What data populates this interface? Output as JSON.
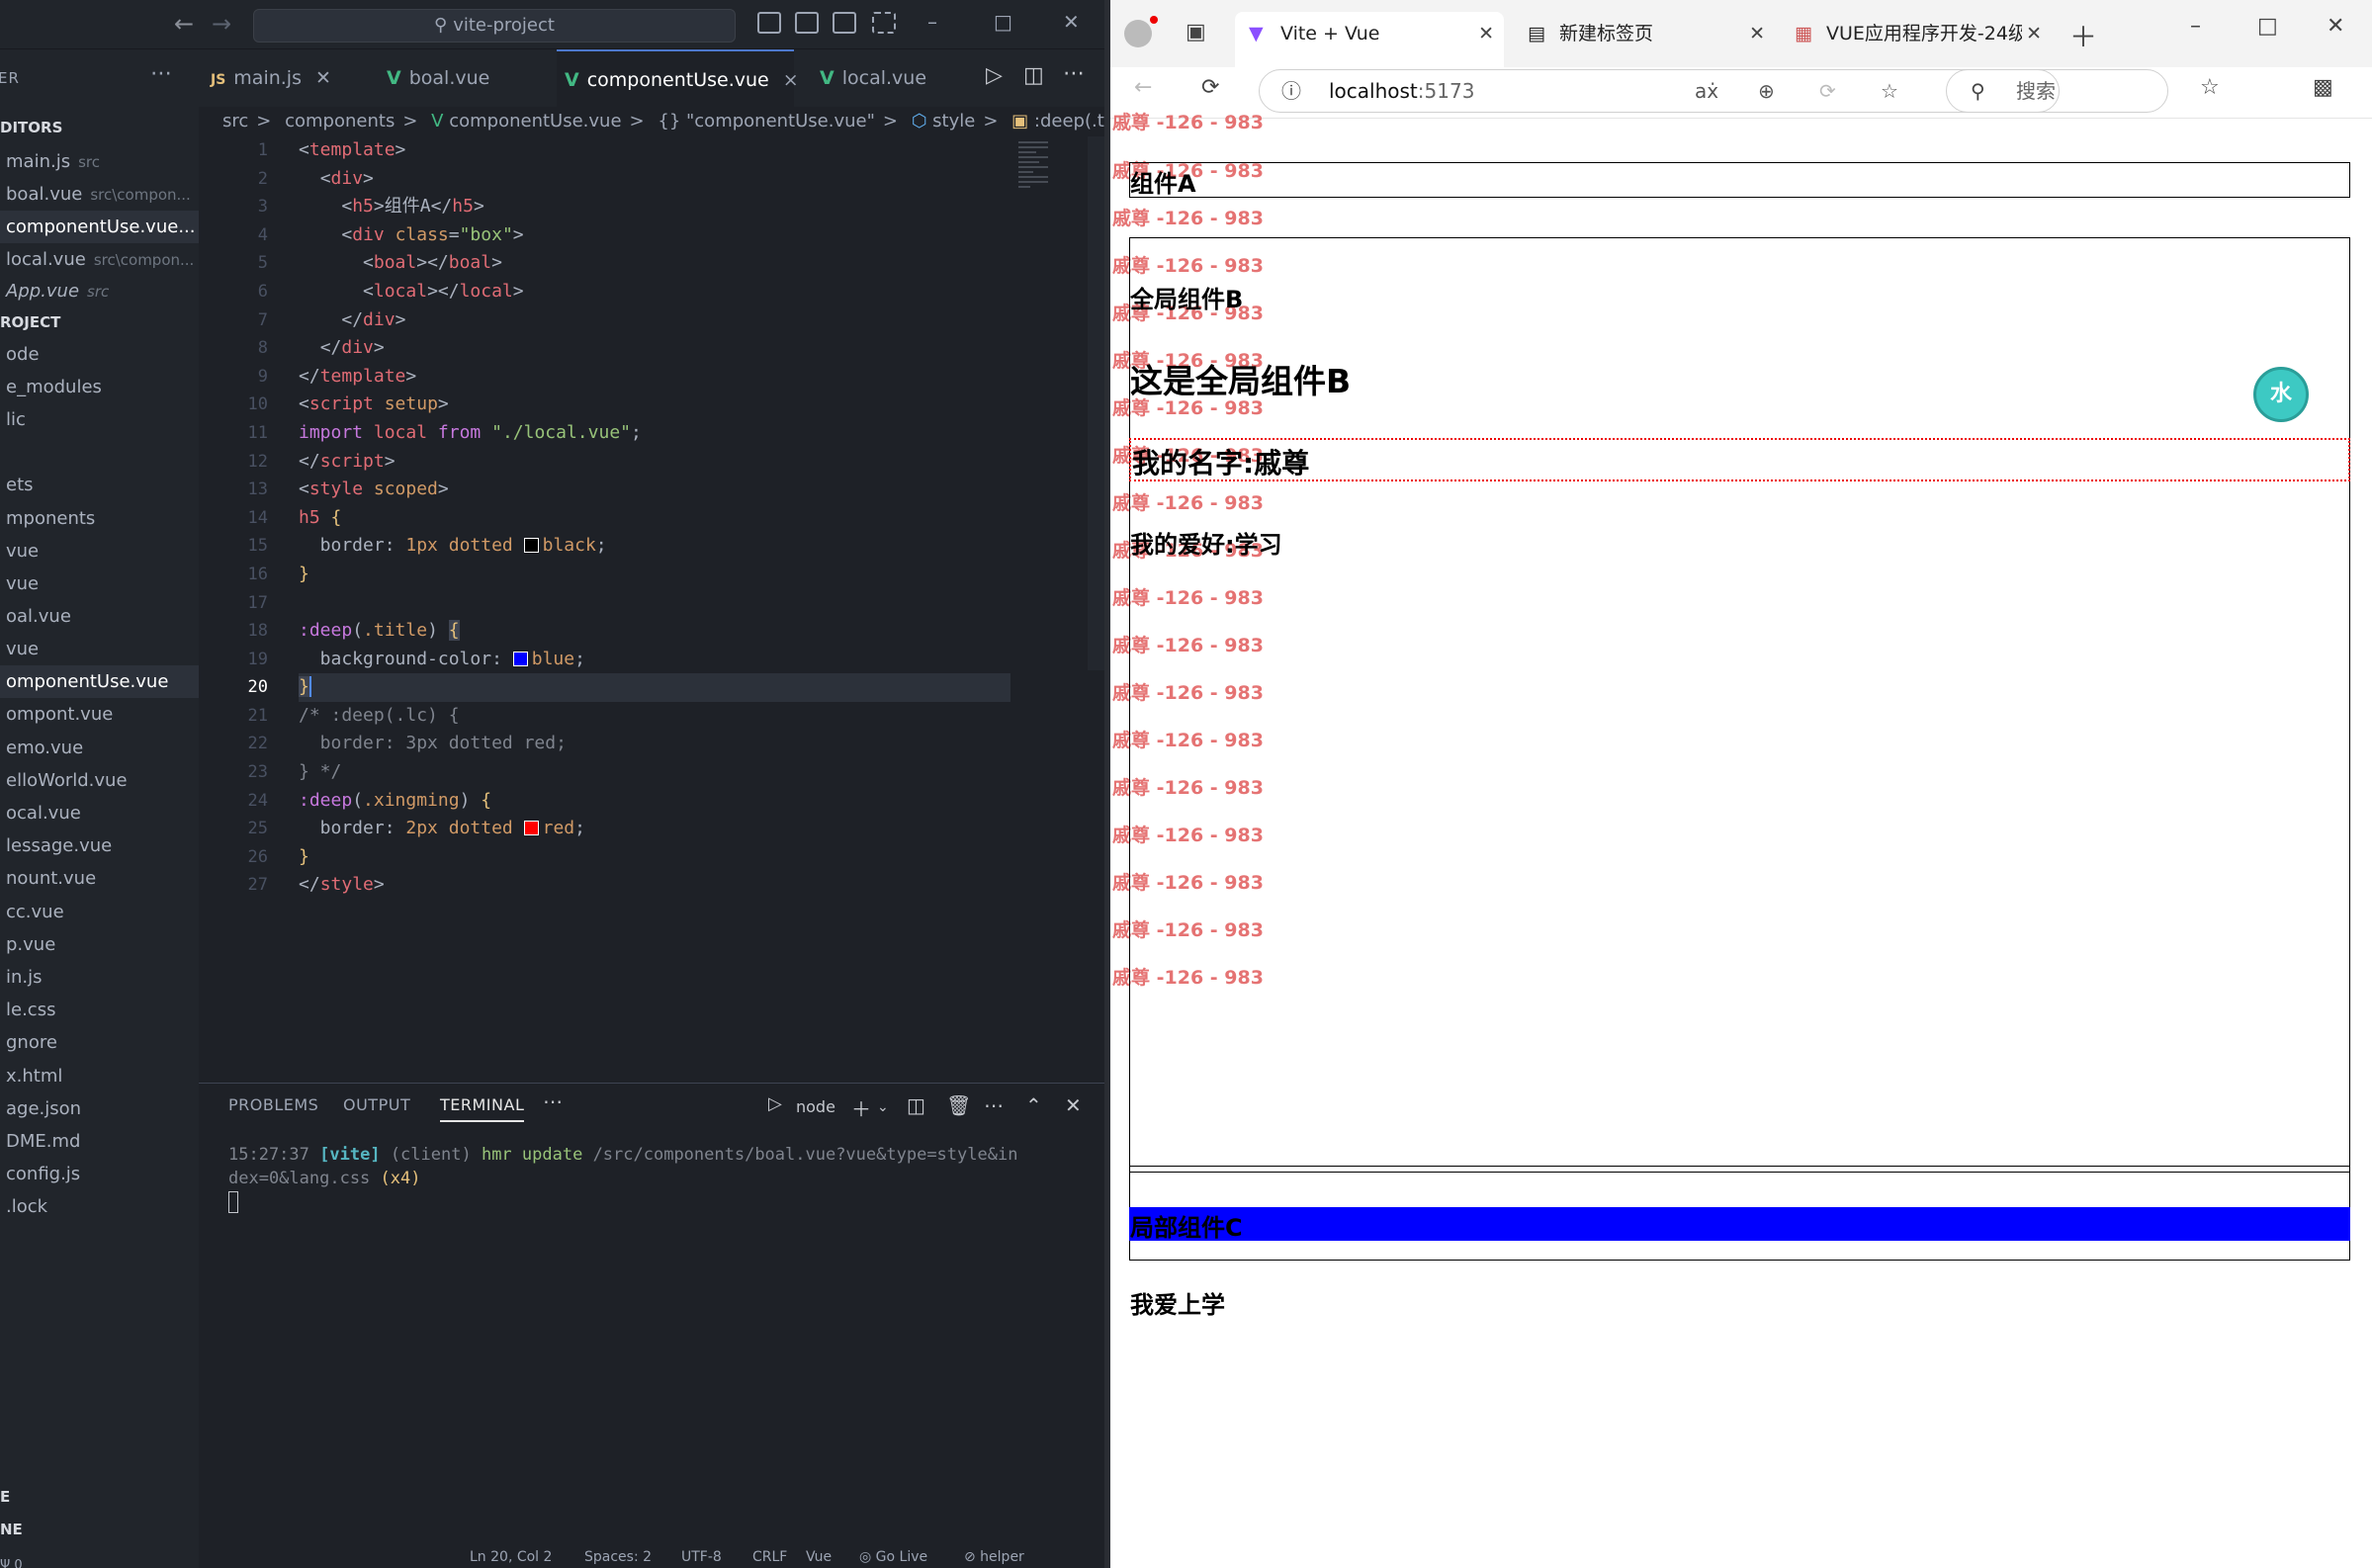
{
  "vscode": {
    "search_label": "vite-project",
    "explorer_title": "ER",
    "sidebar": [
      {
        "label": "DITORS",
        "type": "sec"
      },
      {
        "label": "main.js",
        "dim": "src"
      },
      {
        "label": "boal.vue",
        "dim": "src\\compon..."
      },
      {
        "label": "componentUse.vue...",
        "sel": true
      },
      {
        "label": "local.vue",
        "dim": "src\\compon..."
      },
      {
        "label": "App.vue",
        "dim": "src",
        "italic": true
      },
      {
        "label": "ROJECT",
        "type": "sec"
      },
      {
        "label": "ode"
      },
      {
        "label": "e_modules"
      },
      {
        "label": "lic"
      },
      {
        "label": ""
      },
      {
        "label": "ets"
      },
      {
        "label": "mponents"
      },
      {
        "label": "vue"
      },
      {
        "label": "vue"
      },
      {
        "label": "oal.vue"
      },
      {
        "label": "vue"
      },
      {
        "label": "omponentUse.vue",
        "sel": true
      },
      {
        "label": "ompont.vue"
      },
      {
        "label": "emo.vue"
      },
      {
        "label": "elloWorld.vue"
      },
      {
        "label": "ocal.vue"
      },
      {
        "label": "lessage.vue"
      },
      {
        "label": "nount.vue"
      },
      {
        "label": "cc.vue"
      },
      {
        "label": "p.vue"
      },
      {
        "label": "in.js"
      },
      {
        "label": "le.css"
      },
      {
        "label": "gnore"
      },
      {
        "label": "x.html"
      },
      {
        "label": "age.json"
      },
      {
        "label": "DME.md"
      },
      {
        "label": "config.js"
      },
      {
        "label": ".lock"
      }
    ],
    "sidebar_footer": [
      "E",
      "NE",
      "Ψ 0"
    ],
    "tabs": [
      {
        "label": "main.js",
        "kind": "js"
      },
      {
        "label": "boal.vue",
        "kind": "vue"
      },
      {
        "label": "componentUse.vue",
        "kind": "vue",
        "active": true,
        "close": "×"
      },
      {
        "label": "local.vue",
        "kind": "vue"
      }
    ],
    "breadcrumb": [
      "src",
      "components",
      "componentUse.vue",
      "{} \"componentUse.vue\"",
      "style",
      ":deep(.title)"
    ],
    "line_numbers": [
      "1",
      "2",
      "3",
      "4",
      "5",
      "6",
      "7",
      "8",
      "9",
      "10",
      "11",
      "12",
      "13",
      "14",
      "15",
      "16",
      "17",
      "18",
      "19",
      "20",
      "21",
      "22",
      "23",
      "24",
      "25",
      "26",
      "27"
    ],
    "current_line": "20",
    "panel_tabs": [
      "PROBLEMS",
      "OUTPUT",
      "TERMINAL"
    ],
    "terminal_shell": "node",
    "terminal": {
      "time": "15:27:37",
      "tag": "[vite]",
      "client": "(client)",
      "msg": "hmr update",
      "path": "/src/components/boal.vue?vue&type=style&in",
      "path2": "dex=0&lang.css",
      "count": "(x4)"
    },
    "status": [
      "Ln 20, Col 2",
      "Spaces: 2",
      "UTF-8",
      "CRLF",
      "Vue",
      "◎ Go Live",
      "⊘ helper"
    ]
  },
  "browser": {
    "tabs": [
      {
        "label": "Vite + Vue"
      },
      {
        "label": "新建标签页"
      },
      {
        "label": "VUE应用程序开发-24级"
      }
    ],
    "url_host": "localhost",
    "url_port": ":5173",
    "search_placeholder": "搜索",
    "watermark": "戚尊 -126 - 983",
    "content": {
      "h5": "组件A",
      "global_title": "全局组件B",
      "global_big": "这是全局组件B",
      "name": "我的名字:戚尊",
      "hobby": "我的爱好:学习",
      "local_title": "局部组件C",
      "local_text": "我爱上学"
    },
    "avatar_icon": "水"
  },
  "colors": {
    "accent": "#4d78cc",
    "vue": "#42b883",
    "blue_bar": "#0000ff",
    "dotted_red": "#ee0000"
  }
}
